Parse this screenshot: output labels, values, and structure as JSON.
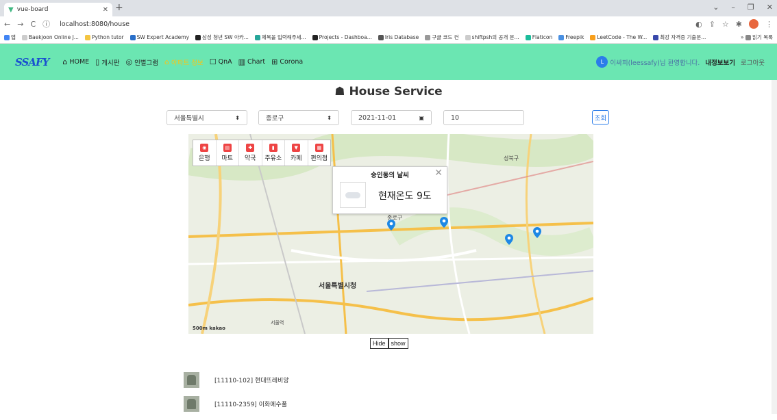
{
  "browser": {
    "tab_title": "vue-board",
    "url": "localhost:8080/house",
    "bookmarks": [
      "앱",
      "Baekjoon Online J...",
      "Python tutor",
      "SW Expert Academy",
      "삼성 청년 SW 아카...",
      "제목을 입력해주세...",
      "Projects - Dashboa...",
      "Iris Database",
      "구글 코드 컨",
      "shiftpsh의 공개 문...",
      "Flaticon",
      "Freepik",
      "LeetCode - The W...",
      "최강 자격증 기출문...",
      "읽기 목록"
    ]
  },
  "nav": {
    "logo": "SSAFY",
    "items": [
      {
        "label": "HOME",
        "icon": "⌂"
      },
      {
        "label": "게시판",
        "icon": "▯"
      },
      {
        "label": "인별그램",
        "icon": "◎"
      },
      {
        "label": "아파트 정보",
        "icon": "⌂"
      },
      {
        "label": "QnA",
        "icon": "☐"
      },
      {
        "label": "Chart",
        "icon": "▥"
      },
      {
        "label": "Corona",
        "icon": "⊞"
      }
    ],
    "avatar_letter": "L",
    "welcome": "이싸피(leessafy)님 환영합니다.",
    "mypage": "내정보보기",
    "logout": "로그아웃"
  },
  "page": {
    "title": "House Service",
    "title_icon": "☗"
  },
  "filters": {
    "city": "서울특별시",
    "district": "종로구",
    "date": "2021-11-01",
    "count": "10",
    "search_label": "조회"
  },
  "map": {
    "categories": [
      "은행",
      "마트",
      "약국",
      "주유소",
      "카페",
      "편의점"
    ],
    "weather_title": "숭인동의 날씨",
    "weather_temp": "현재온도 9도",
    "kakao": "kakao",
    "scale": "500m",
    "labels": [
      "서울특별시청",
      "종로구",
      "성북구",
      "서울역"
    ]
  },
  "buttons": {
    "hide": "Hide",
    "show": "show"
  },
  "list": [
    {
      "label": "[11110-102] 현대뜨레비앙"
    },
    {
      "label": "[11110-2359] 이화에수풀"
    }
  ]
}
